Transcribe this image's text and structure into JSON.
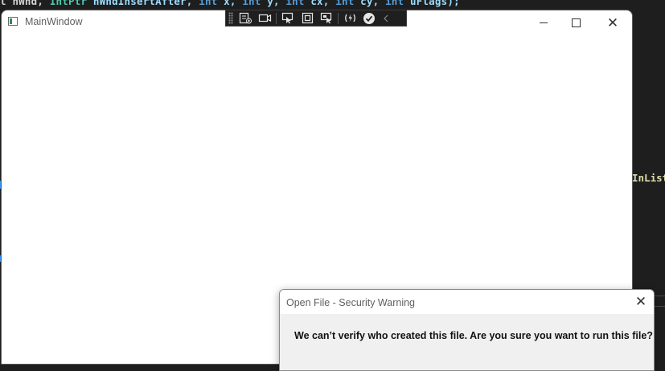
{
  "editor": {
    "code_top": {
      "p1": "l hWnd, ",
      "t1": "IntPtr",
      "p2": " hWndInsertAfter, ",
      "k1": "int",
      "p3": " x, ",
      "k2": "int",
      "p4": " y, ",
      "k3": "int",
      "p5": " cx, ",
      "k4": "int",
      "p6": " cy, ",
      "k5": "int",
      "p7": " uFlags);"
    },
    "code_side": "InList"
  },
  "main_window": {
    "title": "MainWindow",
    "icon": "app-window-icon"
  },
  "debug_toolbar": {
    "tools": [
      {
        "name": "live-visual-tree-icon"
      },
      {
        "name": "camera-icon"
      },
      {
        "name": "select-element-icon"
      },
      {
        "name": "display-layout-adorners-icon"
      },
      {
        "name": "track-focus-icon"
      },
      {
        "name": "hot-reload-icon"
      },
      {
        "name": "checkmark-icon"
      },
      {
        "name": "collapse-chevron-icon"
      }
    ]
  },
  "dialog": {
    "title": "Open File - Security Warning",
    "question": "We can’t verify who created this file. Are you sure you want to run this file?"
  },
  "colors": {
    "editor_bg": "#1e1e1e",
    "keyword": "#569cd6",
    "identifier": "#9cdcfe",
    "method": "#dcdcaa",
    "window_bg": "#ffffff",
    "dialog_body": "#f0f0f0"
  }
}
